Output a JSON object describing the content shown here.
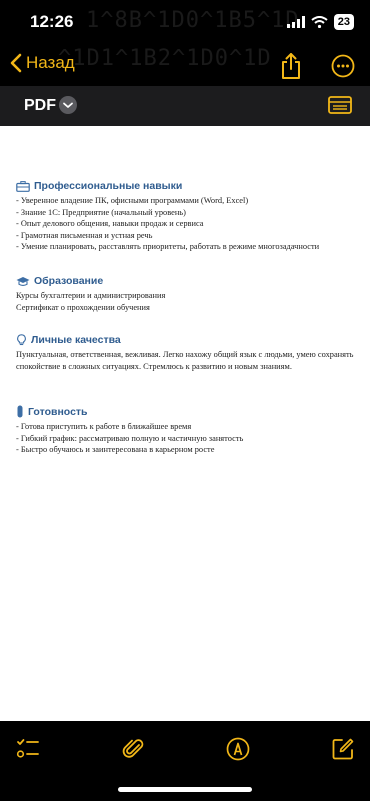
{
  "status_bar": {
    "time": "12:26",
    "battery": "23",
    "ghost_line_1": "1^8B^1D0^1B5^1D",
    "ghost_line_2": "^1D1^1B2^1D0^1D"
  },
  "nav": {
    "back_label": "Назад"
  },
  "pdf_bar": {
    "label": "PDF"
  },
  "document": {
    "sections": [
      {
        "icon": "briefcase-icon",
        "title": "Профессиональные навыки",
        "lines": [
          "- Уверенное владение ПК, офисными программами (Word, Excel)",
          "- Знание 1С: Предприятие (начальный уровень)",
          "- Опыт делового общения, навыки продаж и сервиса",
          "- Грамотная письменная и устная речь",
          "- Умение планировать, расставлять приоритеты, работать в режиме многозадачности"
        ]
      },
      {
        "icon": "graduation-cap-icon",
        "title": "Образование",
        "lines": [
          "Курсы бухгалтерии и администрирования",
          "Сертификат о прохождении обучения"
        ]
      },
      {
        "icon": "lightbulb-icon",
        "title": "Личные качества",
        "paragraph": "Пунктуальная, ответственная, вежливая. Легко нахожу общий язык с людьми, умею сохранять спокойствие в сложных ситуациях. Стремлюсь к развитию и новым знаниям."
      },
      {
        "icon": "thermometer-icon",
        "title": "Готовность",
        "lines": [
          "- Готова приступить к работе в ближайшее время",
          "- Гибкий график: рассматриваю полную и частичную занятость",
          "- Быстро обучаюсь и заинтересована в карьерном росте"
        ]
      }
    ]
  },
  "colors": {
    "accent": "#f2b718",
    "heading": "#2f5c8f"
  }
}
